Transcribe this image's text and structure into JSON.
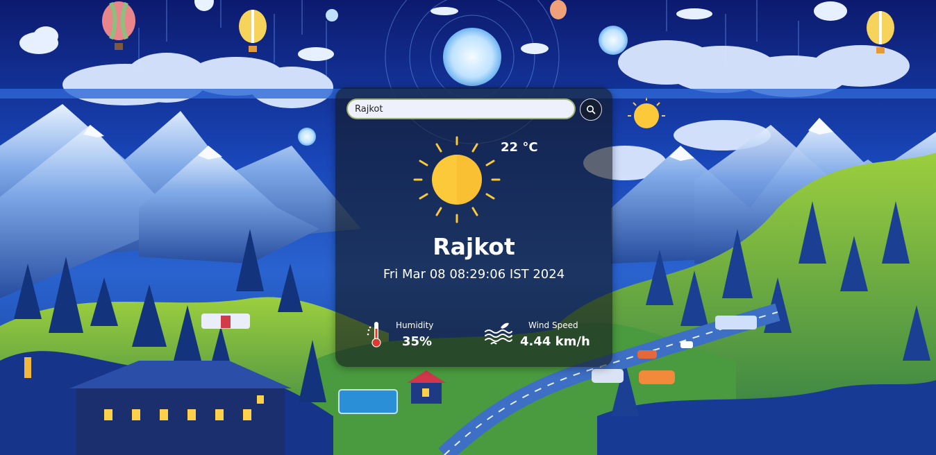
{
  "search": {
    "value": "Rajkot",
    "placeholder": ""
  },
  "weather": {
    "condition_icon": "sun-icon",
    "temperature": "22 °C",
    "city": "Rajkot",
    "datetime": "Fri Mar 08 08:29:06 IST 2024"
  },
  "humidity": {
    "icon": "thermometer-icon",
    "label": "Humidity",
    "value": "35%"
  },
  "wind": {
    "icon": "wind-icon",
    "label": "Wind Speed",
    "value": "4.44 km/h"
  },
  "colors": {
    "sun": "#fcc93a",
    "thermometer": "#e0392f",
    "card_background": "#1e232b"
  }
}
